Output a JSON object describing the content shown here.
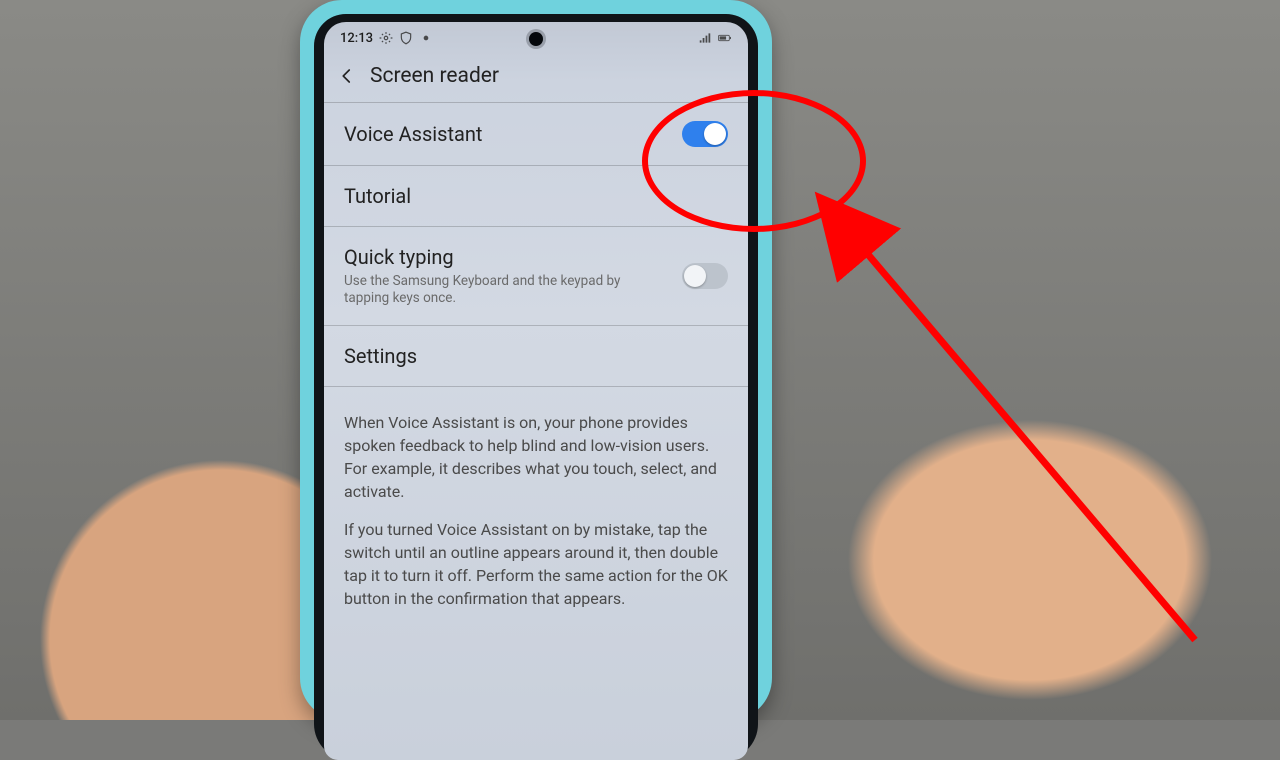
{
  "statusbar": {
    "time": "12:13",
    "left_icons": [
      "gear-icon",
      "shield-icon",
      "dot-icon"
    ],
    "right_icons": [
      "signal-icon",
      "battery-icon"
    ]
  },
  "header": {
    "title": "Screen reader"
  },
  "rows": {
    "voice_assistant": {
      "title": "Voice Assistant",
      "toggle_on": true
    },
    "tutorial": {
      "title": "Tutorial"
    },
    "quick_typing": {
      "title": "Quick typing",
      "sub": "Use the Samsung Keyboard and the keypad by tapping keys once.",
      "toggle_on": false
    },
    "settings": {
      "title": "Settings"
    }
  },
  "info": {
    "p1": "When Voice Assistant is on, your phone provides spoken feedback to help blind and low-vision users. For example, it describes what you touch, select, and activate.",
    "p2": "If you turned Voice Assistant on by mistake, tap the switch until an outline appears around it, then double tap it to turn it off. Perform the same action for the OK button in the confirmation that appears."
  },
  "annotation": {
    "purpose": "Highlight the Voice Assistant toggle",
    "color": "#ff0000"
  }
}
